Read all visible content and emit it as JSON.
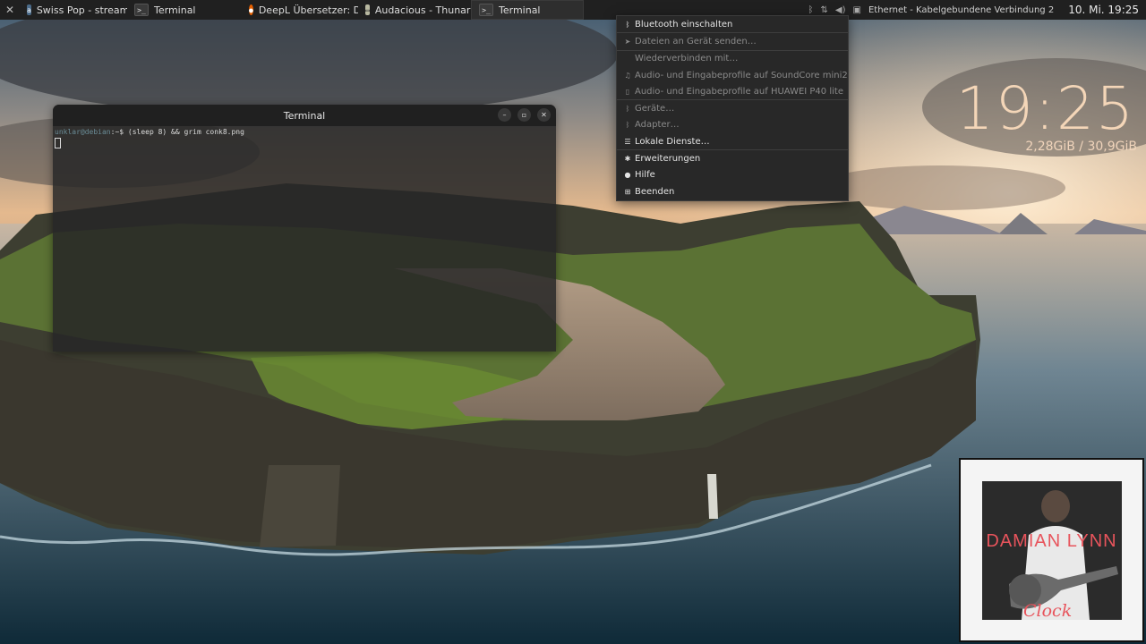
{
  "panel": {
    "launcher_icon": "tools-icon",
    "tasks": [
      {
        "label": "Swiss Pop - stream.sr..",
        "icon": "audio-stream-icon"
      },
      {
        "label": "Terminal",
        "icon": "terminal-icon"
      },
      {
        "label": "DeepL Übersetzer: D..",
        "icon": "firefox-icon"
      },
      {
        "label": "Audacious - Thunar",
        "icon": "folder-icon"
      },
      {
        "label": "Terminal",
        "icon": "terminal-icon",
        "active": true
      }
    ],
    "tray": {
      "network_label": "Ethernet - Kabelgebundene Verbindung 2",
      "clock": "10. Mi. 19:25"
    }
  },
  "terminal": {
    "title": "Terminal",
    "prompt_user": "unklar@debian",
    "prompt_suffix": ":~$ ",
    "command": "(sleep 8) && grim conk8.png"
  },
  "bluetooth_menu": {
    "items": [
      {
        "label": "Bluetooth einschalten",
        "icon": "bluetooth-icon",
        "disabled": false
      },
      {
        "label": "Dateien an Gerät senden…",
        "icon": "send-icon",
        "disabled": true
      },
      {
        "label": "Wiederverbinden mit…",
        "icon": "",
        "disabled": true
      },
      {
        "label": "Audio- und Eingabeprofile auf SoundCore mini2",
        "icon": "headphones-icon",
        "disabled": true
      },
      {
        "label": "Audio- und Eingabeprofile auf HUAWEI P40 lite",
        "icon": "phone-icon",
        "disabled": true
      },
      {
        "label": "Geräte…",
        "icon": "bluetooth-icon",
        "disabled": true
      },
      {
        "label": "Adapter…",
        "icon": "bluetooth-icon",
        "disabled": true
      },
      {
        "label": "Lokale Dienste…",
        "icon": "list-icon",
        "disabled": false
      },
      {
        "label": "Erweiterungen",
        "icon": "puzzle-icon",
        "disabled": false
      },
      {
        "label": "Hilfe",
        "icon": "help-icon",
        "disabled": false
      },
      {
        "label": "Beenden",
        "icon": "quit-icon",
        "disabled": false
      }
    ]
  },
  "conky": {
    "time": "19:25",
    "memory": "2,28GiB / 30,9GiB"
  },
  "album": {
    "artist": "DAMIAN LYNN",
    "title": "Clock"
  }
}
